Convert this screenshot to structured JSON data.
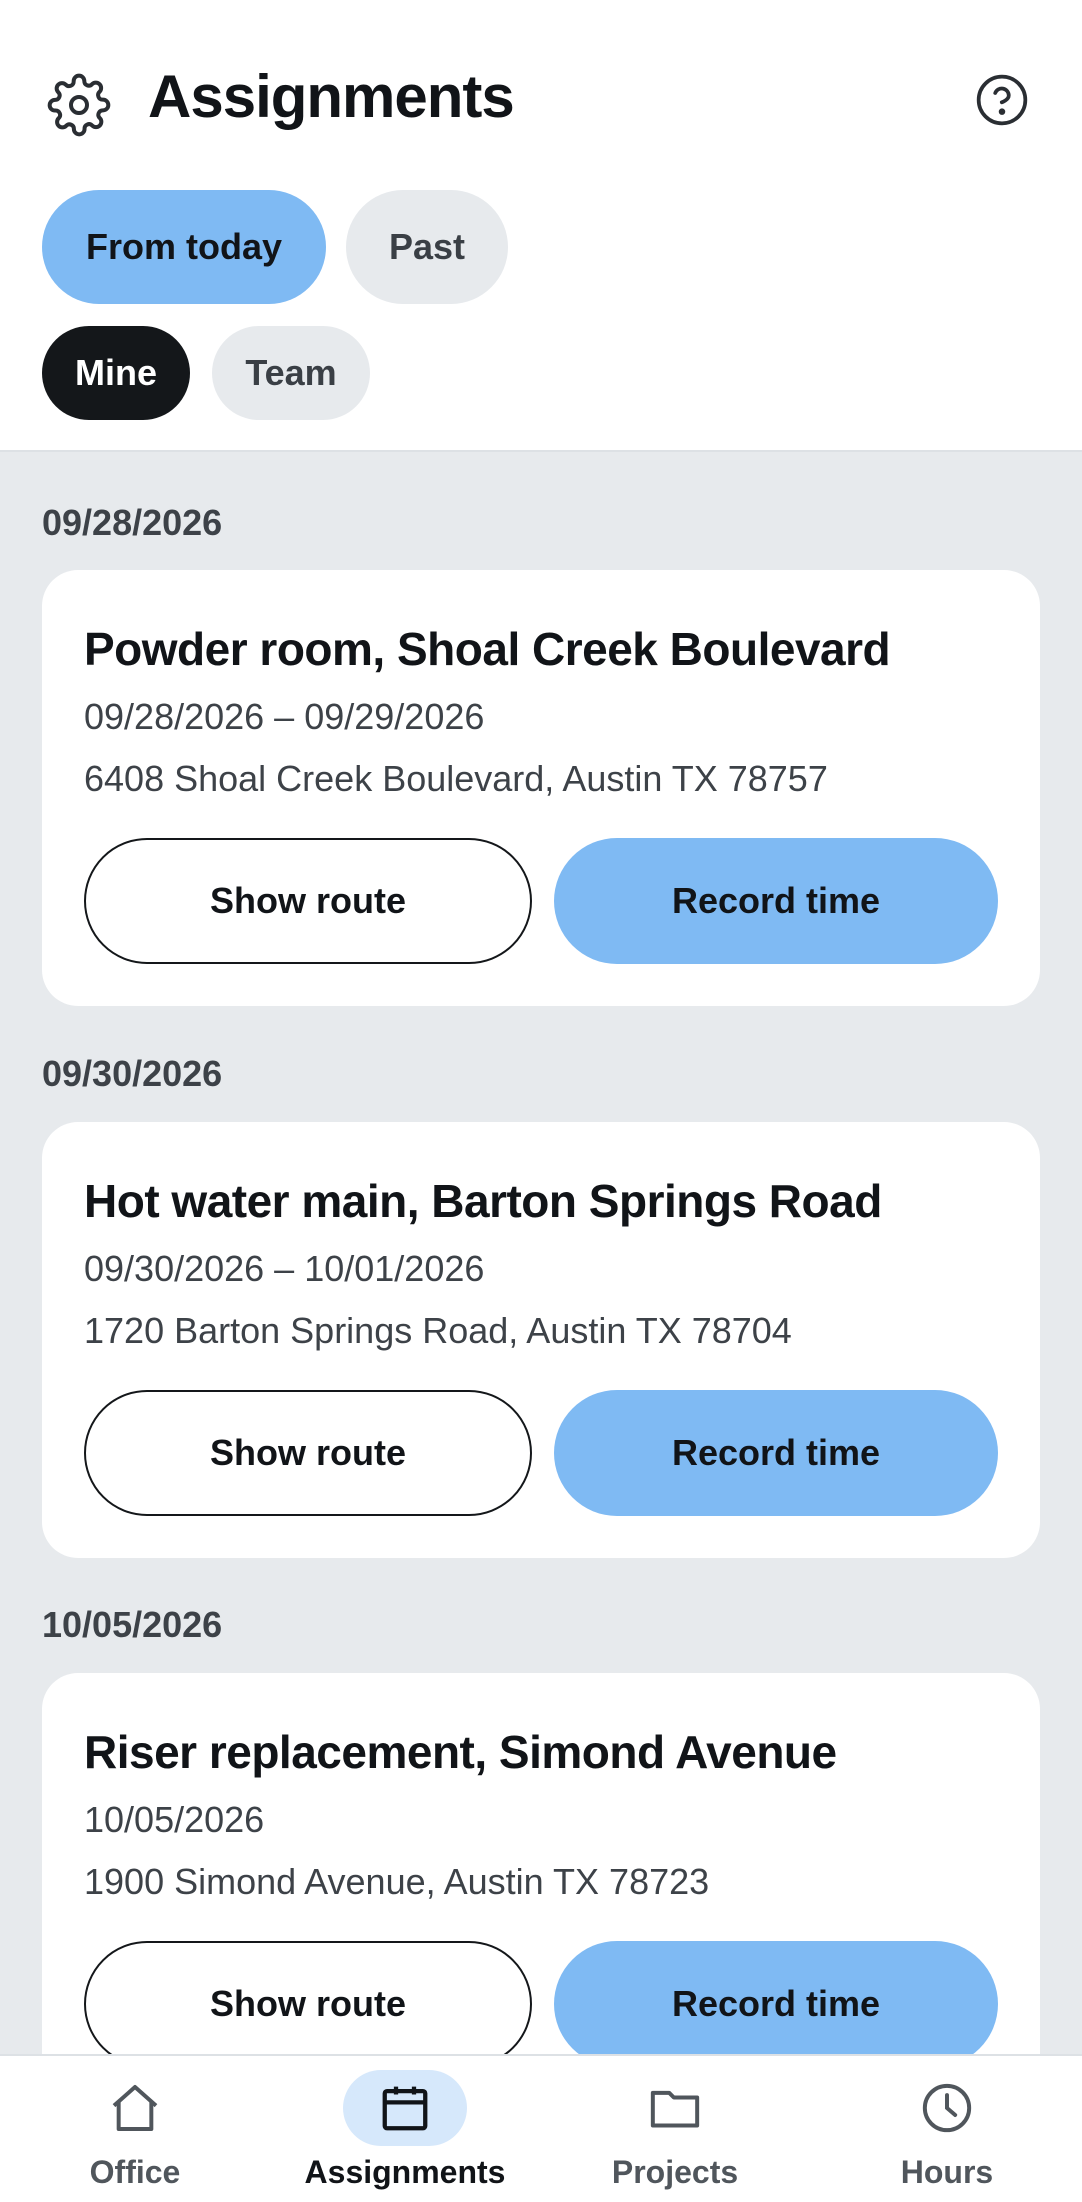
{
  "header": {
    "title": "Assignments",
    "settings_icon": "gear-icon",
    "help_icon": "help-circle-icon"
  },
  "filters": {
    "time": [
      {
        "label": "From today",
        "selected": true
      },
      {
        "label": "Past",
        "selected": false
      }
    ],
    "scope": [
      {
        "label": "Mine",
        "selected": true
      },
      {
        "label": "Team",
        "selected": false
      }
    ]
  },
  "groups": [
    {
      "date": "09/28/2026",
      "title": "Powder room, Shoal Creek Boulevard",
      "dates": "09/28/2026 – 09/29/2026",
      "address": "6408 Shoal Creek Boulevard, Austin TX 78757",
      "route_label": "Show route",
      "record_label": "Record time"
    },
    {
      "date": "09/30/2026",
      "title": "Hot water main, Barton Springs Road",
      "dates": "09/30/2026 – 10/01/2026",
      "address": "1720 Barton Springs Road, Austin TX 78704",
      "route_label": "Show route",
      "record_label": "Record time"
    },
    {
      "date": "10/05/2026",
      "title": "Riser replacement, Simond Avenue",
      "dates": "10/05/2026",
      "address": "1900 Simond Avenue, Austin TX 78723",
      "route_label": "Show route",
      "record_label": "Record time"
    }
  ],
  "nav": [
    {
      "label": "Office",
      "icon": "home-icon",
      "active": false
    },
    {
      "label": "Assignments",
      "icon": "calendar-icon",
      "active": true
    },
    {
      "label": "Projects",
      "icon": "folder-icon",
      "active": false
    },
    {
      "label": "Hours",
      "icon": "clock-icon",
      "active": false
    }
  ],
  "colors": {
    "accent": "#7fbaf3",
    "accent_soft": "#d6e8fb",
    "dark_chip": "#14171a",
    "background": "#e7eaed"
  }
}
